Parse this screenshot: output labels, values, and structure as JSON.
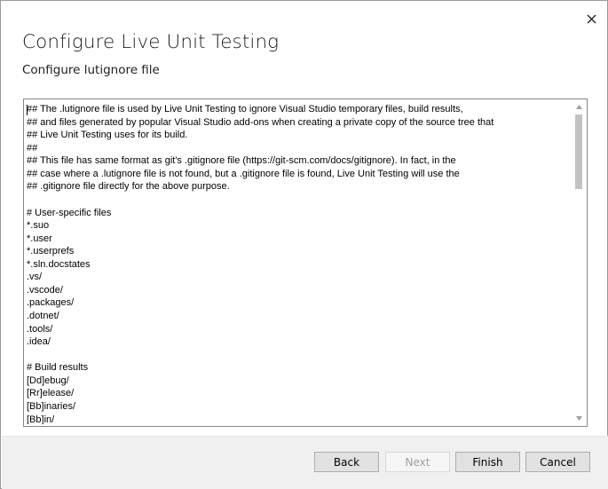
{
  "dialog": {
    "title": "Configure Live Unit Testing",
    "subtitle": "Configure lutignore file",
    "close_icon": "close-icon"
  },
  "editor": {
    "lines": [
      "## The .lutignore file is used by Live Unit Testing to ignore Visual Studio temporary files, build results,",
      "## and files generated by popular Visual Studio add-ons when creating a private copy of the source tree that",
      "## Live Unit Testing uses for its build.",
      "##",
      "## This file has same format as git's .gitignore file (https://git-scm.com/docs/gitignore). In fact, in the",
      "## case where a .lutignore file is not found, but a .gitignore file is found, Live Unit Testing will use the",
      "## .gitignore file directly for the above purpose.",
      "",
      "# User-specific files",
      "*.suo",
      "*.user",
      "*.userprefs",
      "*.sln.docstates",
      ".vs/",
      ".vscode/",
      ".packages/",
      ".dotnet/",
      ".tools/",
      ".idea/",
      "",
      "# Build results",
      "[Dd]ebug/",
      "[Rr]elease/",
      "[Bb]inaries/",
      "[Bb]in/"
    ]
  },
  "footer": {
    "back_label": "Back",
    "next_label": "Next",
    "finish_label": "Finish",
    "cancel_label": "Cancel"
  },
  "colors": {
    "footer_bg": "#f0f0f0",
    "button_bg": "#e1e1e1",
    "disabled_text": "#a0a0a0",
    "scroll_thumb": "#c2c2c2"
  }
}
